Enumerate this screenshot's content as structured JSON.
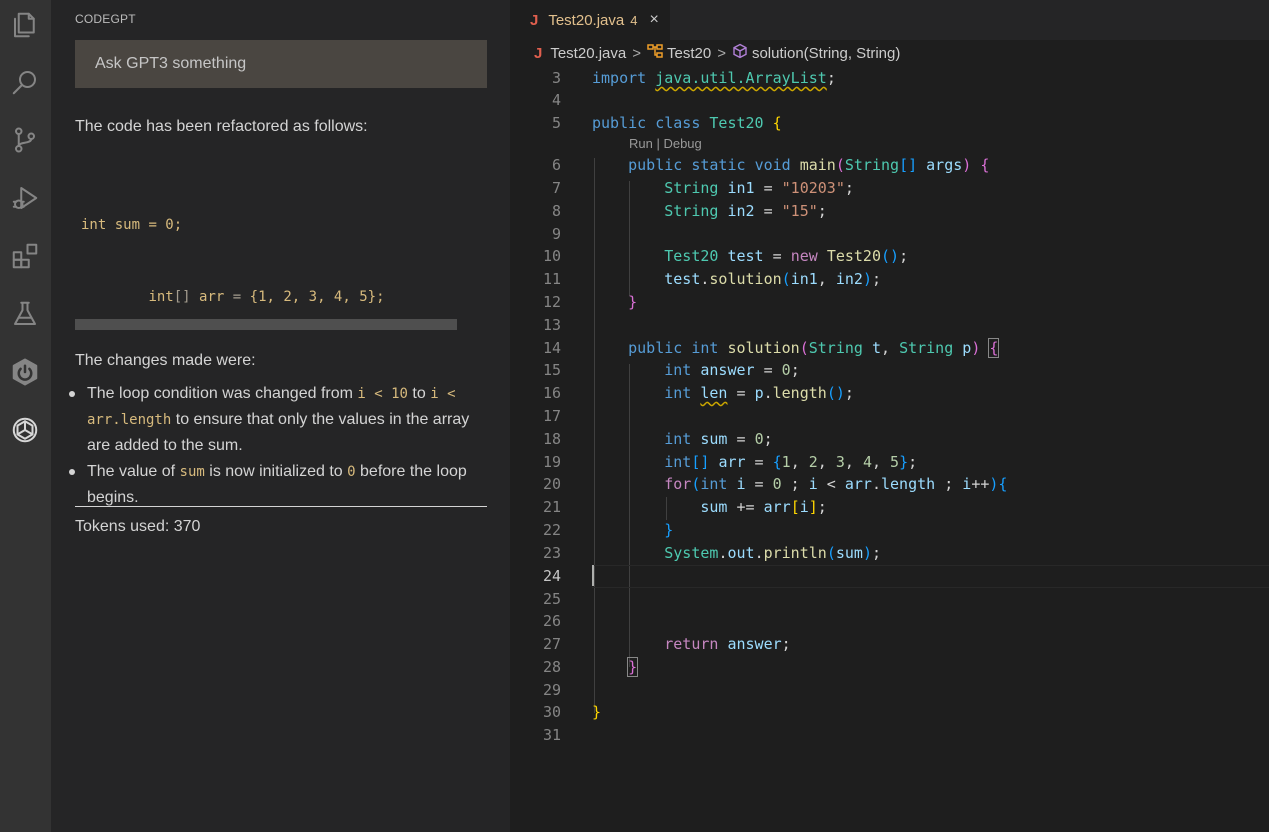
{
  "side_panel": {
    "title": "CODEGPT",
    "ask_placeholder": "Ask GPT3 something",
    "intro": "The code has been refactored as follows:",
    "code_lines": [
      "int sum = 0;",
      "        int[] arr = {1, 2, 3, 4, 5};",
      "        for(int i = 0 ; i < arr.length ; i++){",
      "            sum += arr[i];",
      "        }",
      "        System.out.println(sum);"
    ],
    "changes_title": "The changes made were:",
    "change1": {
      "a": "The loop condition was changed from",
      "code1": "i < 10",
      "b": "to",
      "code2": "i < arr.length",
      "c": "to ensure that only the values in the array are added to the sum."
    },
    "change2": {
      "a": "The value of",
      "code1": "sum",
      "b": "is now initialized to",
      "code2": "0",
      "c": "before the loop begins."
    },
    "tokens": "Tokens used: 370"
  },
  "editor": {
    "tab": {
      "file": "Test20.java",
      "problems": "4",
      "close": "×",
      "icon": "J"
    },
    "breadcrumb": {
      "file": "Test20.java",
      "cls": "Test20",
      "method": "solution(String, String)",
      "sep": ">"
    },
    "codelens": "Run | Debug",
    "active_line": 24,
    "lines": [
      {
        "n": "3",
        "tokens": [
          {
            "c": "k",
            "t": "import "
          },
          {
            "c": "t sq",
            "t": "java.util.ArrayList"
          },
          {
            "c": "",
            "t": ";"
          }
        ]
      },
      {
        "n": "4",
        "tokens": []
      },
      {
        "n": "5",
        "tokens": [
          {
            "c": "k",
            "t": "public "
          },
          {
            "c": "k",
            "t": "class "
          },
          {
            "c": "t",
            "t": "Test20 "
          },
          {
            "c": "p1",
            "t": "{"
          }
        ]
      },
      {
        "n": "6",
        "tokens": [
          {
            "c": "",
            "t": "    "
          },
          {
            "c": "k",
            "t": "public "
          },
          {
            "c": "k",
            "t": "static "
          },
          {
            "c": "k",
            "t": "void "
          },
          {
            "c": "f",
            "t": "main"
          },
          {
            "c": "p2",
            "t": "("
          },
          {
            "c": "t",
            "t": "String"
          },
          {
            "c": "p3",
            "t": "[]"
          },
          {
            "c": "",
            "t": " "
          },
          {
            "c": "v",
            "t": "args"
          },
          {
            "c": "p2",
            "t": ")"
          },
          {
            "c": "",
            "t": " "
          },
          {
            "c": "p2",
            "t": "{"
          }
        ]
      },
      {
        "n": "7",
        "tokens": [
          {
            "c": "",
            "t": "        "
          },
          {
            "c": "t",
            "t": "String "
          },
          {
            "c": "v",
            "t": "in1"
          },
          {
            "c": "",
            "t": " = "
          },
          {
            "c": "s",
            "t": "\"10203\""
          },
          {
            "c": "",
            "t": ";"
          }
        ]
      },
      {
        "n": "8",
        "tokens": [
          {
            "c": "",
            "t": "        "
          },
          {
            "c": "t",
            "t": "String "
          },
          {
            "c": "v",
            "t": "in2"
          },
          {
            "c": "",
            "t": " = "
          },
          {
            "c": "s",
            "t": "\"15\""
          },
          {
            "c": "",
            "t": ";"
          }
        ]
      },
      {
        "n": "9",
        "tokens": []
      },
      {
        "n": "10",
        "tokens": [
          {
            "c": "",
            "t": "        "
          },
          {
            "c": "t",
            "t": "Test20 "
          },
          {
            "c": "v",
            "t": "test"
          },
          {
            "c": "",
            "t": " = "
          },
          {
            "c": "c",
            "t": "new "
          },
          {
            "c": "f",
            "t": "Test20"
          },
          {
            "c": "p3",
            "t": "()"
          },
          {
            "c": "",
            "t": ";"
          }
        ]
      },
      {
        "n": "11",
        "tokens": [
          {
            "c": "",
            "t": "        "
          },
          {
            "c": "v",
            "t": "test"
          },
          {
            "c": "",
            "t": "."
          },
          {
            "c": "f",
            "t": "solution"
          },
          {
            "c": "p3",
            "t": "("
          },
          {
            "c": "v",
            "t": "in1"
          },
          {
            "c": "",
            "t": ", "
          },
          {
            "c": "v",
            "t": "in2"
          },
          {
            "c": "p3",
            "t": ")"
          },
          {
            "c": "",
            "t": ";"
          }
        ]
      },
      {
        "n": "12",
        "tokens": [
          {
            "c": "",
            "t": "    "
          },
          {
            "c": "p2",
            "t": "}"
          }
        ]
      },
      {
        "n": "13",
        "tokens": []
      },
      {
        "n": "14",
        "tokens": [
          {
            "c": "",
            "t": "    "
          },
          {
            "c": "k",
            "t": "public "
          },
          {
            "c": "k",
            "t": "int "
          },
          {
            "c": "f",
            "t": "solution"
          },
          {
            "c": "p2",
            "t": "("
          },
          {
            "c": "t",
            "t": "String "
          },
          {
            "c": "v",
            "t": "t"
          },
          {
            "c": "",
            "t": ", "
          },
          {
            "c": "t",
            "t": "String "
          },
          {
            "c": "v",
            "t": "p"
          },
          {
            "c": "p2",
            "t": ")"
          },
          {
            "c": "",
            "t": " "
          },
          {
            "c": "p2 bx",
            "t": "{"
          }
        ]
      },
      {
        "n": "15",
        "tokens": [
          {
            "c": "",
            "t": "        "
          },
          {
            "c": "k",
            "t": "int "
          },
          {
            "c": "v",
            "t": "answer"
          },
          {
            "c": "",
            "t": " = "
          },
          {
            "c": "n",
            "t": "0"
          },
          {
            "c": "",
            "t": ";"
          }
        ]
      },
      {
        "n": "16",
        "tokens": [
          {
            "c": "",
            "t": "        "
          },
          {
            "c": "k",
            "t": "int "
          },
          {
            "c": "v sq",
            "t": "len"
          },
          {
            "c": "",
            "t": " = "
          },
          {
            "c": "v",
            "t": "p"
          },
          {
            "c": "",
            "t": "."
          },
          {
            "c": "f",
            "t": "length"
          },
          {
            "c": "p3",
            "t": "()"
          },
          {
            "c": "",
            "t": ";"
          }
        ]
      },
      {
        "n": "17",
        "tokens": []
      },
      {
        "n": "18",
        "tokens": [
          {
            "c": "",
            "t": "        "
          },
          {
            "c": "k",
            "t": "int "
          },
          {
            "c": "v",
            "t": "sum"
          },
          {
            "c": "",
            "t": " = "
          },
          {
            "c": "n",
            "t": "0"
          },
          {
            "c": "",
            "t": ";"
          }
        ]
      },
      {
        "n": "19",
        "tokens": [
          {
            "c": "",
            "t": "        "
          },
          {
            "c": "k",
            "t": "int"
          },
          {
            "c": "p3",
            "t": "[]"
          },
          {
            "c": "",
            "t": " "
          },
          {
            "c": "v",
            "t": "arr"
          },
          {
            "c": "",
            "t": " = "
          },
          {
            "c": "p3",
            "t": "{"
          },
          {
            "c": "n",
            "t": "1"
          },
          {
            "c": "",
            "t": ", "
          },
          {
            "c": "n",
            "t": "2"
          },
          {
            "c": "",
            "t": ", "
          },
          {
            "c": "n",
            "t": "3"
          },
          {
            "c": "",
            "t": ", "
          },
          {
            "c": "n",
            "t": "4"
          },
          {
            "c": "",
            "t": ", "
          },
          {
            "c": "n",
            "t": "5"
          },
          {
            "c": "p3",
            "t": "}"
          },
          {
            "c": "",
            "t": ";"
          }
        ]
      },
      {
        "n": "20",
        "tokens": [
          {
            "c": "",
            "t": "        "
          },
          {
            "c": "c",
            "t": "for"
          },
          {
            "c": "p3",
            "t": "("
          },
          {
            "c": "k",
            "t": "int "
          },
          {
            "c": "v",
            "t": "i"
          },
          {
            "c": "",
            "t": " = "
          },
          {
            "c": "n",
            "t": "0"
          },
          {
            "c": "",
            "t": " ; "
          },
          {
            "c": "v",
            "t": "i"
          },
          {
            "c": "",
            "t": " < "
          },
          {
            "c": "v",
            "t": "arr"
          },
          {
            "c": "",
            "t": "."
          },
          {
            "c": "v",
            "t": "length"
          },
          {
            "c": "",
            "t": " ; "
          },
          {
            "c": "v",
            "t": "i"
          },
          {
            "c": "",
            "t": "++"
          },
          {
            "c": "p3",
            "t": ")"
          },
          {
            "c": "p3",
            "t": "{"
          }
        ]
      },
      {
        "n": "21",
        "tokens": [
          {
            "c": "",
            "t": "            "
          },
          {
            "c": "v",
            "t": "sum"
          },
          {
            "c": "",
            "t": " += "
          },
          {
            "c": "v",
            "t": "arr"
          },
          {
            "c": "p1",
            "t": "["
          },
          {
            "c": "v",
            "t": "i"
          },
          {
            "c": "p1",
            "t": "]"
          },
          {
            "c": "",
            "t": ";"
          }
        ]
      },
      {
        "n": "22",
        "tokens": [
          {
            "c": "",
            "t": "        "
          },
          {
            "c": "p3",
            "t": "}"
          }
        ]
      },
      {
        "n": "23",
        "tokens": [
          {
            "c": "",
            "t": "        "
          },
          {
            "c": "t",
            "t": "System"
          },
          {
            "c": "",
            "t": "."
          },
          {
            "c": "v",
            "t": "out"
          },
          {
            "c": "",
            "t": "."
          },
          {
            "c": "f",
            "t": "println"
          },
          {
            "c": "p3",
            "t": "("
          },
          {
            "c": "v",
            "t": "sum"
          },
          {
            "c": "p3",
            "t": ")"
          },
          {
            "c": "",
            "t": ";"
          }
        ]
      },
      {
        "n": "24",
        "tokens": []
      },
      {
        "n": "25",
        "tokens": []
      },
      {
        "n": "26",
        "tokens": []
      },
      {
        "n": "27",
        "tokens": [
          {
            "c": "",
            "t": "        "
          },
          {
            "c": "c",
            "t": "return "
          },
          {
            "c": "v",
            "t": "answer"
          },
          {
            "c": "",
            "t": ";"
          }
        ]
      },
      {
        "n": "28",
        "tokens": [
          {
            "c": "",
            "t": "    "
          },
          {
            "c": "p2 bx",
            "t": "}"
          }
        ]
      },
      {
        "n": "29",
        "tokens": []
      },
      {
        "n": "30",
        "tokens": [
          {
            "c": "p1",
            "t": "}"
          }
        ]
      },
      {
        "n": "31",
        "tokens": []
      }
    ]
  },
  "activity_bar": [
    "files-icon",
    "search-icon",
    "source-control-icon",
    "run-debug-icon",
    "extensions-icon",
    "testing-icon",
    "spring-boot-icon",
    "codegpt-icon"
  ]
}
